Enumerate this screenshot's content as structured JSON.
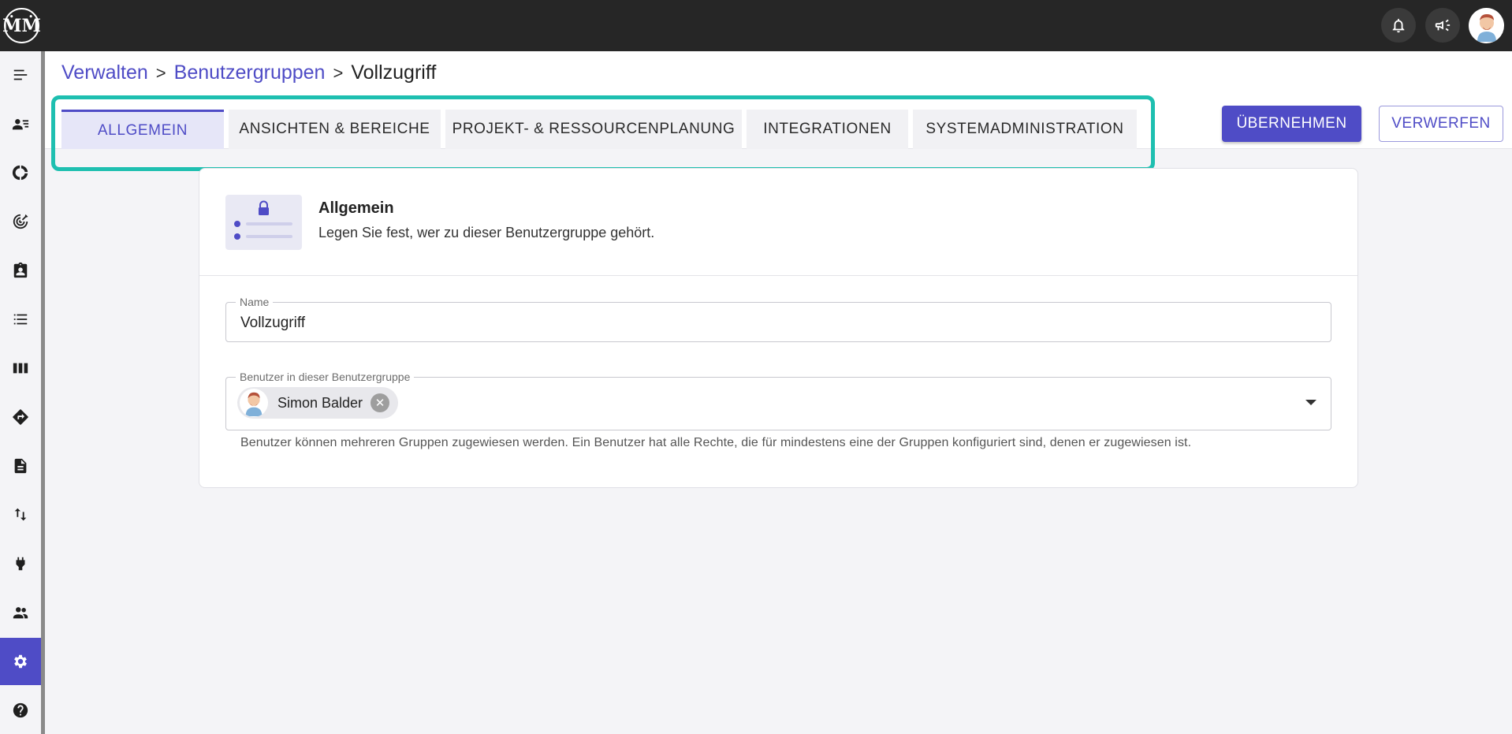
{
  "topbar": {
    "logo_text": "ṀṀ",
    "icons": [
      "bell-icon",
      "megaphone-icon",
      "user-avatar"
    ]
  },
  "sidebar": {
    "items": [
      {
        "name": "menu-icon"
      },
      {
        "name": "contacts-icon"
      },
      {
        "name": "donut-chart-icon"
      },
      {
        "name": "target-icon"
      },
      {
        "name": "clipboard-user-icon"
      },
      {
        "name": "list-icon"
      },
      {
        "name": "columns-icon"
      },
      {
        "name": "directions-icon"
      },
      {
        "name": "document-icon"
      },
      {
        "name": "sort-arrows-icon"
      },
      {
        "name": "plug-icon"
      },
      {
        "name": "people-icon"
      },
      {
        "name": "gear-icon",
        "active": true
      },
      {
        "name": "help-icon"
      }
    ],
    "accent": "#4f4cc6"
  },
  "breadcrumb": {
    "items": [
      "Verwalten",
      "Benutzergruppen"
    ],
    "separator": ">",
    "current": "Vollzugriff"
  },
  "tabs": [
    {
      "label": "ALLGEMEIN",
      "active": true
    },
    {
      "label": "ANSICHTEN & BEREICHE"
    },
    {
      "label": "PROJEKT- & RESSOURCENPLANUNG"
    },
    {
      "label": "INTEGRATIONEN"
    },
    {
      "label": "SYSTEMADMINISTRATION"
    }
  ],
  "actions": {
    "apply_label": "ÜBERNEHMEN",
    "discard_label": "VERWERFEN"
  },
  "card": {
    "title": "Allgemein",
    "description": "Legen Sie fest, wer zu dieser Benutzergruppe gehört.",
    "name_field": {
      "label": "Name",
      "value": "Vollzugriff"
    },
    "users_field": {
      "label": "Benutzer in dieser Benutzergruppe",
      "chips": [
        {
          "name": "Simon Balder"
        }
      ]
    },
    "helper": "Benutzer können mehreren Gruppen zugewiesen werden. Ein Benutzer hat alle Rechte, die für mindestens eine der Gruppen konfiguriert sind, denen er zugewiesen ist."
  },
  "colors": {
    "primary": "#4f4cc6",
    "highlight": "#1ebfb0",
    "topbar": "#262626"
  }
}
